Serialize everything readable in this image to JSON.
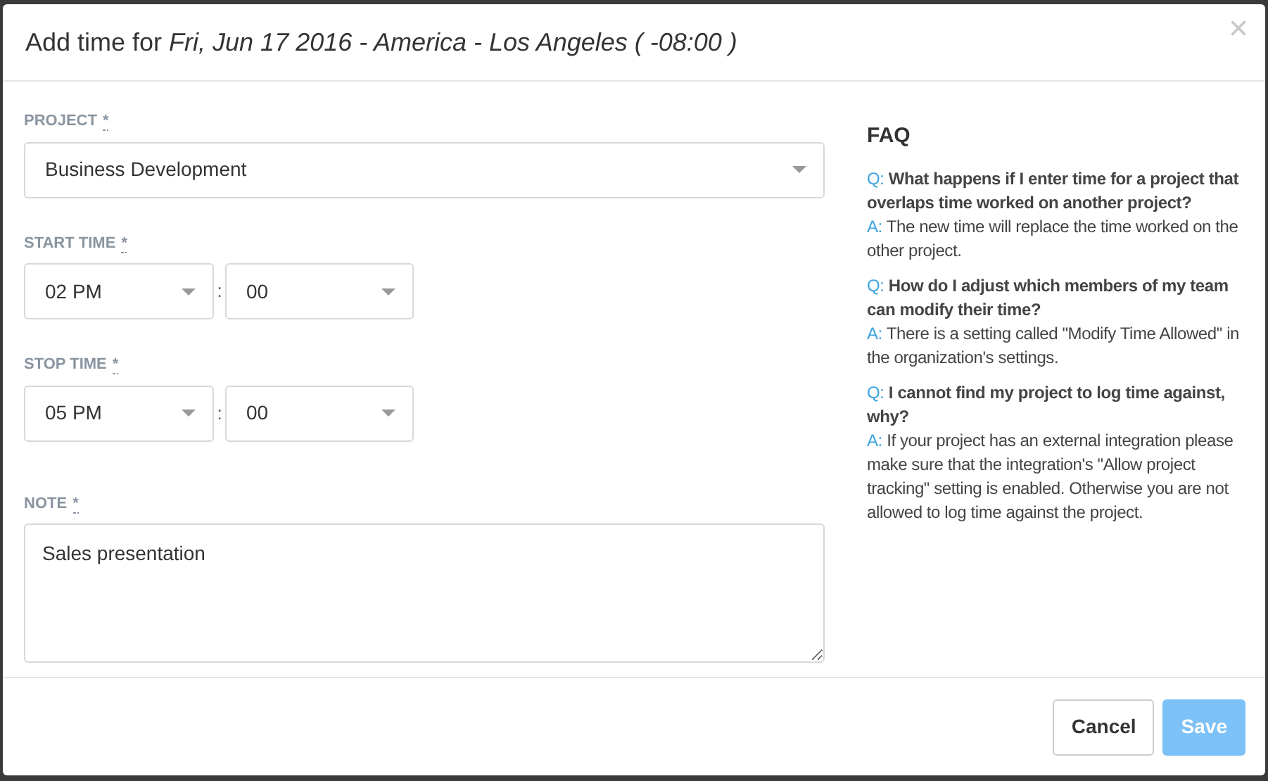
{
  "dialog": {
    "title": "Add time for *Fri, Jun 17 2016 - America - Los Angeles ( -08:00 )*",
    "close": "×"
  },
  "form": {
    "project": {
      "label": "PROJECT",
      "required": "*",
      "value": "Business Development"
    },
    "start_time": {
      "label": "START TIME",
      "required": "*",
      "hour": "02 PM",
      "separator": ":",
      "minute": "00"
    },
    "stop_time": {
      "label": "STOP TIME",
      "required": "*",
      "hour": "05 PM",
      "separator": ":",
      "minute": "00"
    },
    "note": {
      "label": "NOTE",
      "required": "*",
      "value": "Sales presentation"
    }
  },
  "faq": {
    "title": "FAQ",
    "items": [
      {
        "q_label": "Q:",
        "question": "What happens if I enter time for a project that overlaps time worked on another project?",
        "a_label": "A:",
        "answer": "The new time will replace the time worked on the other project."
      },
      {
        "q_label": "Q:",
        "question": "How do I adjust which members of my team can modify their time?",
        "a_label": "A:",
        "answer": "There is a setting called \"Modify Time Allowed\" in the organization's settings."
      },
      {
        "q_label": "Q:",
        "question": "I cannot find my project to log time against, why?",
        "a_label": "A:",
        "answer": "If your project has an external integration please make sure that the integration's \"Allow project tracking\" setting is enabled. Otherwise you are not allowed to log time against the project."
      }
    ]
  },
  "footer": {
    "buttons": [
      {
        "label": "Cancel",
        "kind": "secondary",
        "disabled": false
      },
      {
        "label": "Save",
        "kind": "primary",
        "disabled": true
      }
    ]
  }
}
